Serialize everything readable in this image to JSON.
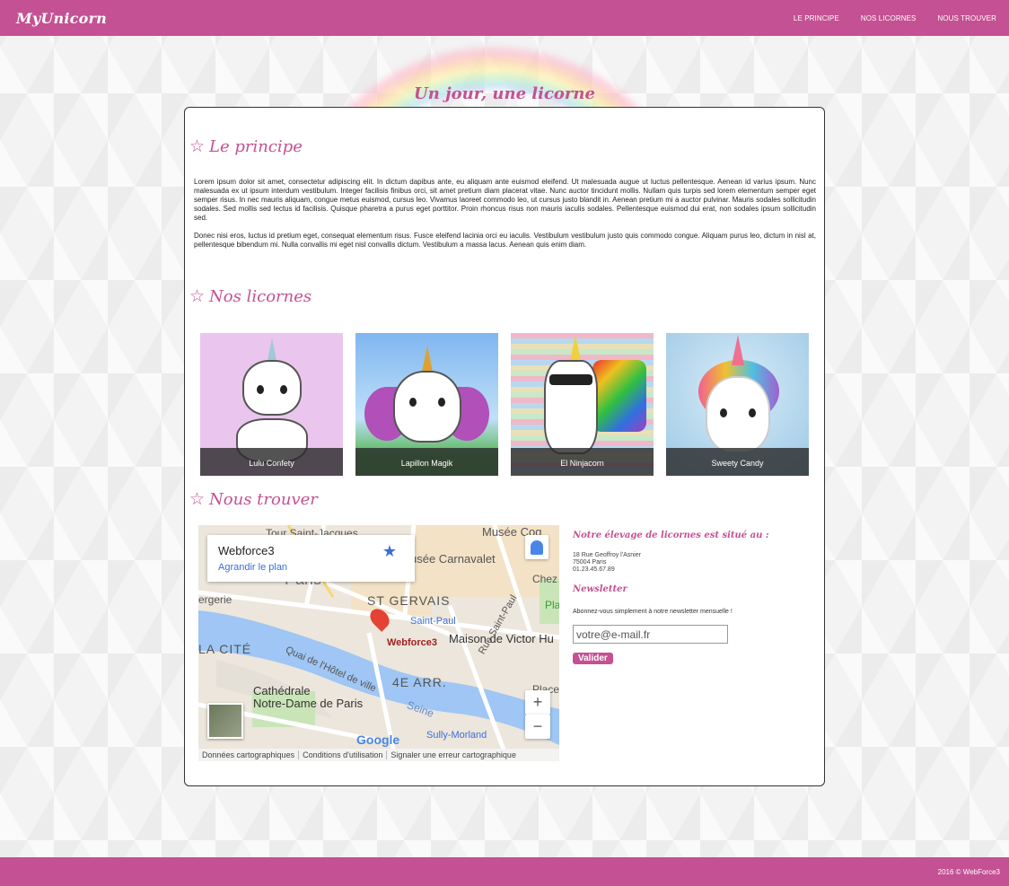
{
  "header": {
    "brand": "MyUnicorn",
    "nav": [
      "LE PRINCIPE",
      "NOS LICORNES",
      "NOUS TROUVER"
    ]
  },
  "hero": {
    "title": "Un jour, une licorne"
  },
  "principe": {
    "title": "Le principe",
    "paragraph1": "Lorem ipsum dolor sit amet, consectetur adipiscing elit. In dictum dapibus ante, eu aliquam ante euismod eleifend. Ut malesuada augue ut luctus pellentesque. Aenean id varius ipsum. Nunc malesuada ex ut ipsum interdum vestibulum. Integer facilisis finibus orci, sit amet pretium diam placerat vitae. Nunc auctor tincidunt mollis. Nullam quis turpis sed lorem elementum semper eget semper risus. In nec mauris aliquam, congue metus euismod, cursus leo. Vivamus laoreet commodo leo, ut cursus justo blandit in. Aenean pretium mi a auctor pulvinar. Mauris sodales sollicitudin sodales. Sed mollis sed lectus id facilisis. Quisque pharetra a purus eget porttitor. Proin rhoncus risus non mauris iaculis sodales. Pellentesque euismod dui erat, non sodales ipsum sollicitudin sed.",
    "paragraph2": "Donec nisi eros, luctus id pretium eget, consequat elementum risus. Fusce eleifend lacinia orci eu iaculis. Vestibulum vestibulum justo quis commodo congue. Aliquam purus leo, dictum in nisl at, pellentesque bibendum mi. Nulla convallis mi eget nisl convallis dictum. Vestibulum a massa lacus. Aenean quis enim diam."
  },
  "licornes": {
    "title": "Nos licornes",
    "items": [
      {
        "name": "Lulu Confety",
        "color": "#eac6ee"
      },
      {
        "name": "Lapillon Magik",
        "color": "#9cc8ef"
      },
      {
        "name": "El Ninjacorn",
        "color": "#b9d7ea"
      },
      {
        "name": "Sweety Candy",
        "color": "#a9d3ea"
      }
    ]
  },
  "trouver": {
    "title": "Nous trouver",
    "map": {
      "place_name": "Webforce3",
      "enlarge_link": "Agrandir le plan",
      "labels": {
        "musee_cognacq": "Musée Cog",
        "musee_carnavalet": "usée Carnavalet",
        "st_gervais": "ST GERVAIS",
        "saint_paul": "Saint-Paul",
        "maison_victor": "Maison de Victor Hu",
        "la_cite": "LA CITÉ",
        "cathedrale1": "Cathédrale",
        "cathedrale2": "Notre-Dame de Paris",
        "quatre_arr": "4E ARR.",
        "sully": "Sully-Morland",
        "seine": "Seine",
        "paris": "Paris",
        "ergerie": "ergerie",
        "quai": "Quai de l'Hôtel de ville",
        "pin_label": "Webforce3",
        "tour_st_jacques": "Tour Saint-Jacques",
        "chez": "Chez",
        "place": "Place",
        "pla": "Pla",
        "rue_saint_paul": "Rue Saint-Paul"
      },
      "zoom_in": "+",
      "zoom_out": "−",
      "footer": [
        "Données cartographiques",
        "Conditions d'utilisation",
        "Signaler une erreur cartographique"
      ],
      "google": "Google"
    },
    "info_title": "Notre élevage de licornes est situé au :",
    "address": [
      "18 Rue Geoffroy l'Asnier",
      "75004 Paris",
      "01.23.45.67.89"
    ],
    "newsletter_title": "Newsletter",
    "newsletter_text": "Abonnez-vous simplement à notre newsletter mensuelle !",
    "email_value": "votre@e-mail.fr",
    "submit_label": "Valider"
  },
  "footer": {
    "copyright": "2016 © WebForce3"
  },
  "colors": {
    "accent": "#c45193",
    "link": "#3a6fd8"
  }
}
